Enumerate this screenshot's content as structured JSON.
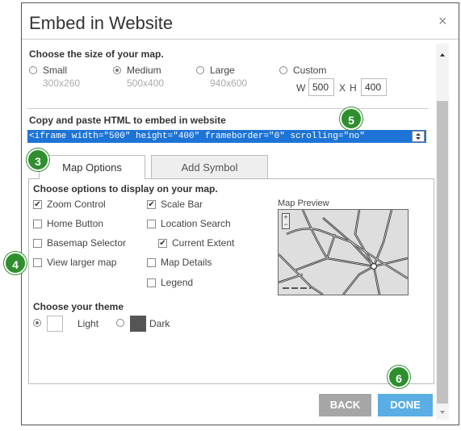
{
  "dialog": {
    "title": "Embed in Website",
    "close_glyph": "×"
  },
  "size_section": {
    "label": "Choose the size of your map.",
    "options": [
      {
        "label": "Small",
        "dims": "300x260",
        "selected": false
      },
      {
        "label": "Medium",
        "dims": "500x400",
        "selected": true
      },
      {
        "label": "Large",
        "dims": "940x600",
        "selected": false
      },
      {
        "label": "Custom",
        "dims": "",
        "selected": false
      }
    ],
    "custom": {
      "w_label": "W",
      "w_value": "500",
      "x_label": "X",
      "h_label": "H",
      "h_value": "400"
    }
  },
  "embed": {
    "label": "Copy and paste HTML to embed in website",
    "code": "<iframe width=\"500\" height=\"400\" frameborder=\"0\" scrolling=\"no\""
  },
  "tabs": [
    {
      "label": "Map Options",
      "active": true
    },
    {
      "label": "Add Symbol",
      "active": false
    }
  ],
  "options": {
    "label": "Choose options to display on your map.",
    "left": [
      {
        "label": "Zoom Control",
        "checked": true
      },
      {
        "label": "Home Button",
        "checked": false
      },
      {
        "label": "Basemap Selector",
        "checked": false
      },
      {
        "label": "View larger map",
        "checked": false
      }
    ],
    "right": [
      {
        "label": "Scale Bar",
        "checked": true
      },
      {
        "label": "Location Search",
        "checked": false
      },
      {
        "label": "Current Extent",
        "checked": true
      },
      {
        "label": "Map Details",
        "checked": false
      },
      {
        "label": "Legend",
        "checked": false
      }
    ]
  },
  "preview": {
    "label": "Map Preview",
    "zoom_in": "+",
    "zoom_out": "−"
  },
  "theme": {
    "label": "Choose your theme",
    "options": [
      {
        "label": "Light",
        "selected": true,
        "color": "#ffffff"
      },
      {
        "label": "Dark",
        "selected": false,
        "color": "#555555"
      }
    ]
  },
  "buttons": {
    "back": "BACK",
    "done": "DONE"
  },
  "badges": [
    "3",
    "4",
    "5",
    "6"
  ],
  "colors": {
    "accent": "#1e74d6",
    "badge": "#2f8f2f",
    "done": "#5aaee5",
    "back": "#a6a6a6"
  }
}
